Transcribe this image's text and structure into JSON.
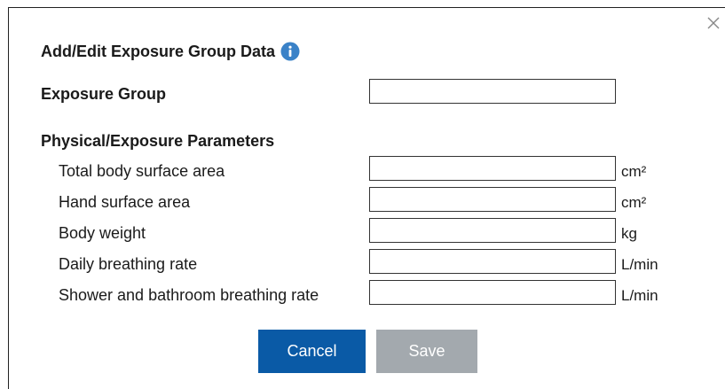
{
  "dialog": {
    "title": "Add/Edit Exposure Group Data",
    "close_glyph": "×"
  },
  "exposure_group": {
    "label": "Exposure Group",
    "value": ""
  },
  "physical": {
    "heading": "Physical/Exposure Parameters",
    "rows": [
      {
        "label": "Total body surface area",
        "value": "",
        "unit": "cm²"
      },
      {
        "label": "Hand surface area",
        "value": "",
        "unit": "cm²"
      },
      {
        "label": "Body weight",
        "value": "",
        "unit": "kg"
      },
      {
        "label": "Daily breathing rate",
        "value": "",
        "unit": "L/min"
      },
      {
        "label": "Shower and bathroom breathing rate",
        "value": "",
        "unit": "L/min"
      }
    ]
  },
  "buttons": {
    "cancel": "Cancel",
    "save": "Save"
  },
  "colors": {
    "primary": "#0a5aa6",
    "disabled": "#a3a9ae",
    "info": "#3a82c8"
  }
}
